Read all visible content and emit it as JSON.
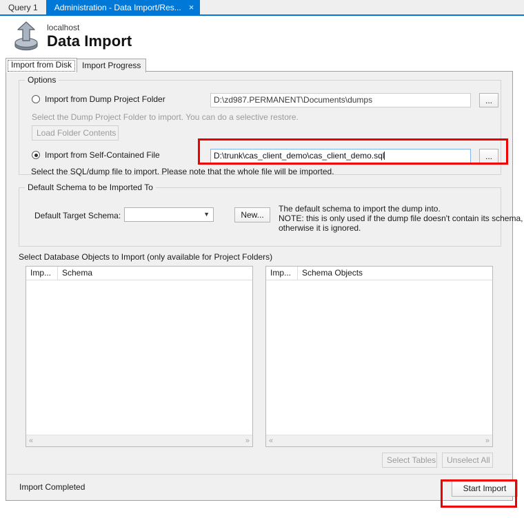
{
  "window": {
    "editor_tabs": [
      {
        "label": "Query 1",
        "active": false,
        "closable": false
      },
      {
        "label": "Administration - Data Import/Res...",
        "active": true,
        "closable": true,
        "close_glyph": "×"
      }
    ],
    "accent_color": "#0078d7"
  },
  "header": {
    "host": "localhost",
    "title": "Data Import",
    "icon": "upload-icon"
  },
  "inner_tabs": [
    {
      "label": "Import from Disk",
      "active": true
    },
    {
      "label": "Import Progress",
      "active": false
    }
  ],
  "options": {
    "group_title": "Options",
    "dump_folder_radio": {
      "label": "Import from Dump Project Folder",
      "checked": false
    },
    "dump_folder_path": "D:\\zd987.PERMANENT\\Documents\\dumps",
    "dump_folder_browse": "...",
    "dump_folder_hint": "Select the Dump Project Folder to import. You can do a selective restore.",
    "load_folder_button": "Load Folder Contents",
    "self_contained_radio": {
      "label": "Import from Self-Contained File",
      "checked": true
    },
    "self_contained_path": "D:\\trunk\\cas_client_demo\\cas_client_demo.sql",
    "self_contained_browse": "...",
    "self_contained_hint": "Select the SQL/dump file to import. Please note that the whole file will be imported."
  },
  "schema": {
    "group_title": "Default Schema to be Imported To",
    "target_label": "Default Target Schema:",
    "target_value": "",
    "new_button": "New...",
    "note_line1": "The default schema to import the dump into.",
    "note_line2": "NOTE: this is only used if the dump file doesn't contain its schema,",
    "note_line3": "otherwise it is ignored."
  },
  "objects": {
    "section_label": "Select Database Objects to Import (only available for Project Folders)",
    "schema_list": {
      "columns": [
        "Imp...",
        "Schema"
      ],
      "rows": []
    },
    "objects_list": {
      "columns": [
        "Imp...",
        "Schema Objects"
      ],
      "rows": []
    },
    "scroll_left_glyph": "«",
    "scroll_right_glyph": "»",
    "select_tables_button": "Select Tables",
    "unselect_all_button": "Unselect All"
  },
  "footer": {
    "status": "Import Completed",
    "start_import_button": "Start Import"
  },
  "annotations": {
    "highlight_color": "#ee0000",
    "boxes": [
      "self-contained-file-input",
      "start-import-button"
    ]
  }
}
